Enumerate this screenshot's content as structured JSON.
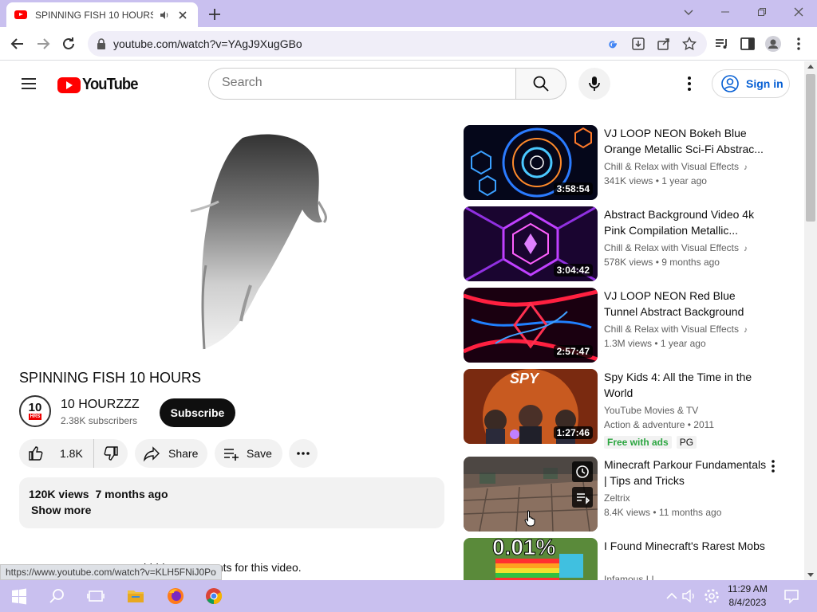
{
  "browser": {
    "tab_title": "SPINNING FISH 10 HOURS -",
    "url": "youtube.com/watch?v=YAgJ9XugGBo",
    "status_url": "https://www.youtube.com/watch?v=KLH5FNiJ0Po"
  },
  "header": {
    "logo_text": "YouTube",
    "search_placeholder": "Search",
    "signin_label": "Sign in"
  },
  "video": {
    "title": "SPINNING FISH 10 HOURS",
    "channel_name": "10 HOURZZZ",
    "avatar_num": "10",
    "avatar_sub": "HRS",
    "subscribers": "2.38K subscribers",
    "subscribe_label": "Subscribe",
    "likes": "1.8K",
    "share_label": "Share",
    "save_label": "Save",
    "views": "120K views",
    "age": "7 months ago",
    "show_more": "Show more",
    "comments_note": "                   hidden comments for this video."
  },
  "recommendations": [
    {
      "title": "VJ LOOP NEON Bokeh Blue Orange Metallic Sci-Fi Abstrac...",
      "channel": "Chill & Relax with Visual Effects",
      "views": "341K views",
      "age": "1 year ago",
      "duration": "3:58:54"
    },
    {
      "title": "Abstract Background Video 4k Pink Compilation Metallic...",
      "channel": "Chill & Relax with Visual Effects",
      "views": "578K views",
      "age": "9 months ago",
      "duration": "3:04:42"
    },
    {
      "title": "VJ LOOP NEON Red Blue Tunnel Abstract Background Video...",
      "channel": "Chill & Relax with Visual Effects",
      "views": "1.3M views",
      "age": "1 year ago",
      "duration": "2:57:47"
    },
    {
      "title": "Spy Kids 4: All the Time in the World",
      "channel": "YouTube Movies & TV",
      "meta": "Action & adventure • 2011",
      "free_label": "Free with ads",
      "rating": "PG",
      "duration": "1:27:46",
      "thumb_text": "SPY"
    },
    {
      "title": "Minecraft Parkour Fundamentals | Tips and Tricks",
      "channel": "Zeltrix",
      "views": "8.4K views",
      "age": "11 months ago"
    },
    {
      "title": "I Found Minecraft's Rarest Mobs",
      "channel": "Infamous LI",
      "thumb_text": "0.01%"
    }
  ],
  "taskbar": {
    "time": "11:29 AM",
    "date": "8/4/2023"
  },
  "colors": {
    "youtube_red": "#ff0000",
    "signin_blue": "#065fd4",
    "chrome_frame": "#c9c0ef"
  }
}
